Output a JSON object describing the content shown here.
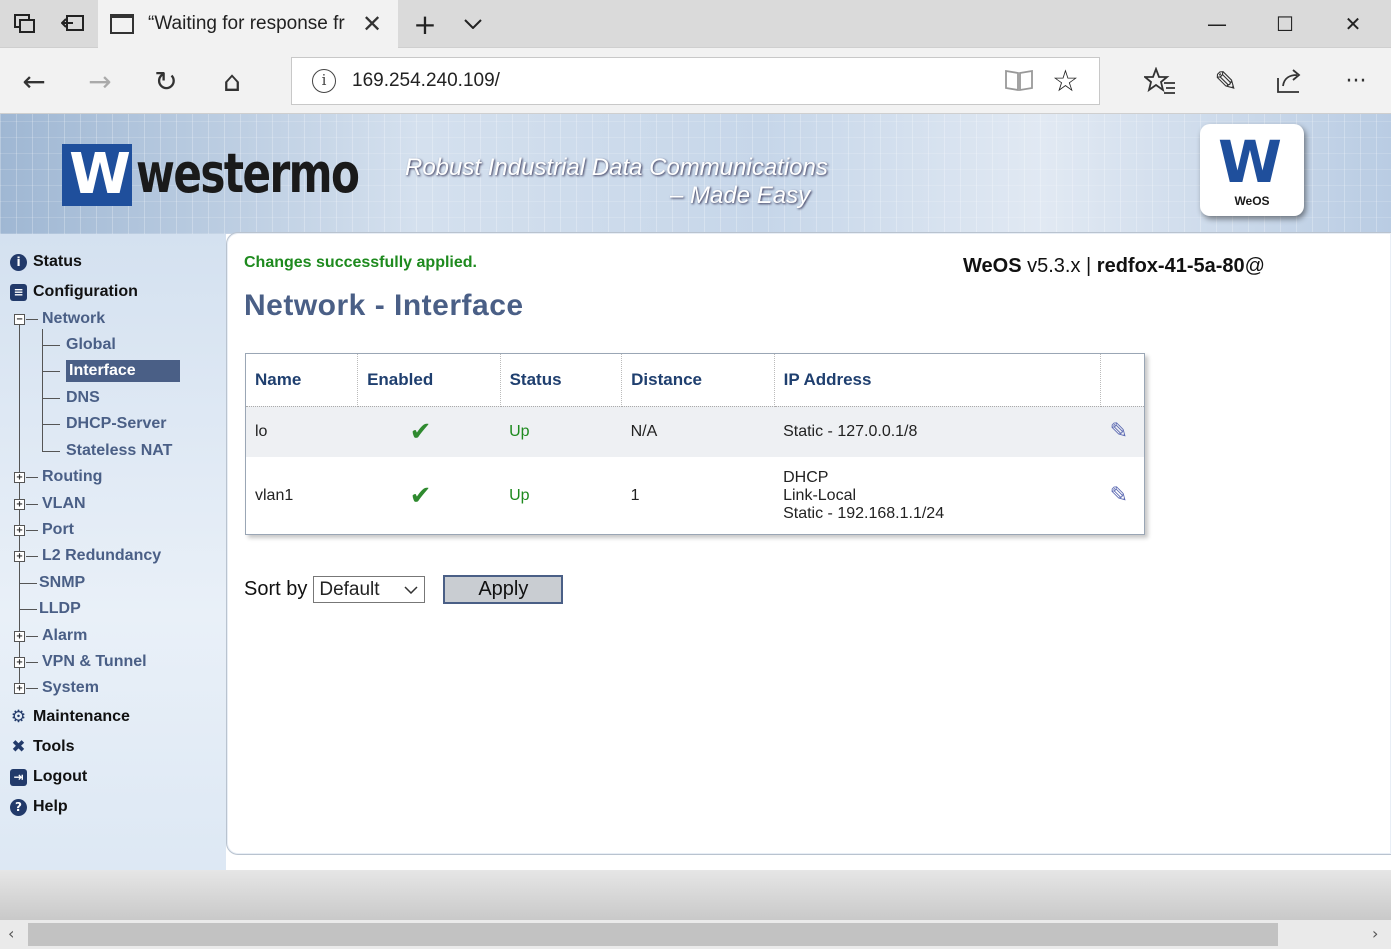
{
  "browser": {
    "tab_title": "“Waiting for response fr",
    "url": "169.254.240.109/",
    "icons": {
      "tab_actions": "tab-actions-icon",
      "set_aside": "set-aside-tabs-icon",
      "new_tab": "+",
      "tab_dropdown": "⌄",
      "minimize": "—",
      "maximize": "☐",
      "close": "✕",
      "back": "←",
      "forward": "→",
      "refresh": "↻",
      "home": "⌂",
      "info": "i",
      "reading_view": "▯▯",
      "favorite": "☆",
      "favorites_hub": "☆≡",
      "notes": "✎",
      "share": "⇪",
      "more": "···"
    }
  },
  "banner": {
    "logo_mark": "W",
    "logo_text": "westermo",
    "tagline_line1": "Robust Industrial Data Communications",
    "tagline_line2": "– Made Easy",
    "badge_label": "WeOS"
  },
  "sidebar": {
    "top": {
      "status": "Status",
      "configuration": "Configuration",
      "maintenance": "Maintenance",
      "tools": "Tools",
      "logout": "Logout",
      "help": "Help"
    },
    "network": "Network",
    "network_children": {
      "global": "Global",
      "interface": "Interface",
      "dns": "DNS",
      "dhcp_server": "DHCP-Server",
      "stateless_nat": "Stateless NAT"
    },
    "config_children": {
      "routing": "Routing",
      "vlan": "VLAN",
      "port": "Port",
      "l2_redundancy": "L2 Redundancy",
      "snmp": "SNMP",
      "lldp": "LLDP",
      "alarm": "Alarm",
      "vpn_tunnel": "VPN & Tunnel",
      "system": "System"
    }
  },
  "main": {
    "notice": "Changes successfully applied.",
    "version_product": "WeOS",
    "version_number": "v5.3.x",
    "version_sep": "|",
    "hostname": "redfox-41-5a-80",
    "at": "@",
    "title": "Network - Interface",
    "table": {
      "headers": {
        "name": "Name",
        "enabled": "Enabled",
        "status": "Status",
        "distance": "Distance",
        "ip": "IP Address",
        "actions": ""
      },
      "rows": [
        {
          "name": "lo",
          "enabled": "✔",
          "status": "Up",
          "distance": "N/A",
          "ip": [
            "Static - 127.0.0.1/8"
          ]
        },
        {
          "name": "vlan1",
          "enabled": "✔",
          "status": "Up",
          "distance": "1",
          "ip": [
            "DHCP",
            "Link-Local",
            "Static - 192.168.1.1/24"
          ]
        }
      ]
    },
    "sort": {
      "label": "Sort by",
      "selected": "Default",
      "apply": "Apply"
    }
  },
  "colors": {
    "accent": "#4a5f86",
    "success": "#1e8a1e",
    "header_text": "#1f3f6f",
    "brand_blue": "#1f4f9c"
  }
}
